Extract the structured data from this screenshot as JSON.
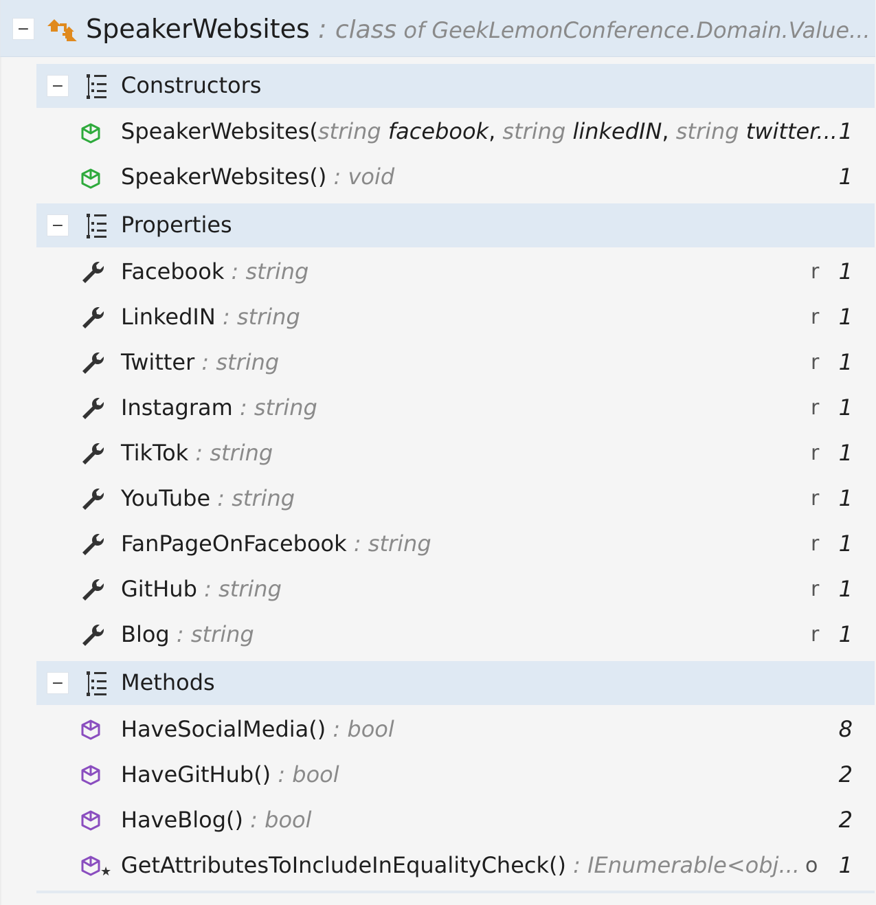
{
  "header": {
    "name": "SpeakerWebsites",
    "separator": " : ",
    "kind": "class",
    "of_word": " of ",
    "namespace": "GeekLemonConference.Domain.Value...",
    "toggle": "−"
  },
  "groups": {
    "constructors": {
      "label": "Constructors",
      "toggle": "−"
    },
    "properties": {
      "label": "Properties",
      "toggle": "−"
    },
    "methods": {
      "label": "Methods",
      "toggle": "−"
    }
  },
  "constructors": [
    {
      "name": "SpeakerWebsites(",
      "p1_type": "string ",
      "p1_name": "facebook",
      "sep1": ", ",
      "p2_type": "string ",
      "p2_name": "linkedIN",
      "sep2": ", ",
      "p3_type": "string ",
      "p3_name": "twitter...",
      "count": "1"
    },
    {
      "name": "SpeakerWebsites()",
      "type": " : void",
      "count": "1"
    }
  ],
  "properties": [
    {
      "name": "Facebook",
      "type": " : string",
      "flag": "r",
      "count": "1"
    },
    {
      "name": "LinkedIN",
      "type": " : string",
      "flag": "r",
      "count": "1"
    },
    {
      "name": "Twitter",
      "type": " : string",
      "flag": "r",
      "count": "1"
    },
    {
      "name": "Instagram",
      "type": " : string",
      "flag": "r",
      "count": "1"
    },
    {
      "name": "TikTok",
      "type": " : string",
      "flag": "r",
      "count": "1"
    },
    {
      "name": "YouTube",
      "type": " : string",
      "flag": "r",
      "count": "1"
    },
    {
      "name": "FanPageOnFacebook",
      "type": " : string",
      "flag": "r",
      "count": "1"
    },
    {
      "name": "GitHub",
      "type": " : string",
      "flag": "r",
      "count": "1"
    },
    {
      "name": "Blog",
      "type": " : string",
      "flag": "r",
      "count": "1"
    }
  ],
  "methods": [
    {
      "name": "HaveSocialMedia()",
      "type": " : bool",
      "flag": "",
      "count": "8"
    },
    {
      "name": "HaveGitHub()",
      "type": " : bool",
      "flag": "",
      "count": "2"
    },
    {
      "name": "HaveBlog()",
      "type": " : bool",
      "flag": "",
      "count": "2"
    },
    {
      "name": "GetAttributesToIncludeInEqualityCheck()",
      "type": " : IEnumerable<obj...",
      "flag": "o",
      "count": "1"
    }
  ],
  "colors": {
    "group_bg": "#dfe9f3",
    "constructor_icon": "#2eaa3c",
    "method_icon": "#8a4dbf",
    "class_icon": "#e08a1e",
    "dim_text": "#8a8a8a"
  }
}
